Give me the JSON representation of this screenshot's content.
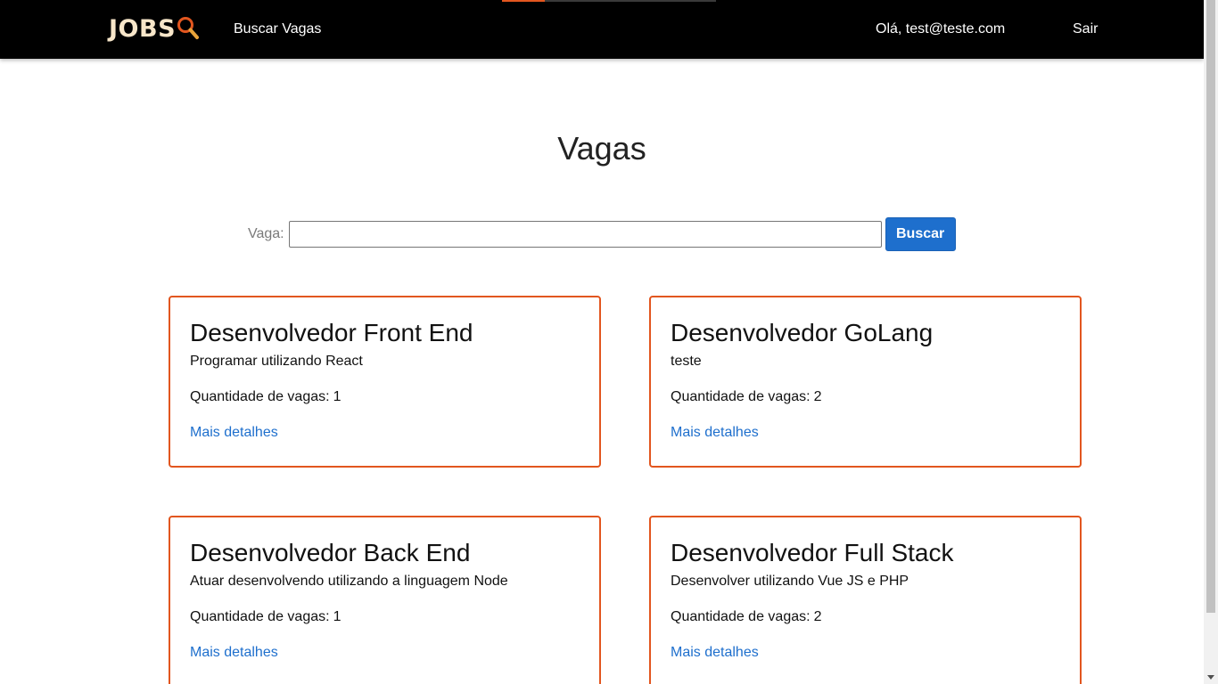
{
  "colors": {
    "navbar_bg": "#000000",
    "accent": "#e2561f",
    "primary": "#1e6fcd",
    "logo_text": "#f7e6c9"
  },
  "navbar": {
    "logo_text": "JOBS",
    "logo_icon": "magnifier-icon",
    "search_link": "Buscar Vagas",
    "greeting": "Olá, test@teste.com",
    "logout": "Sair"
  },
  "page": {
    "title": "Vagas"
  },
  "search": {
    "label": "Vaga:",
    "value": "",
    "button": "Buscar"
  },
  "jobs": [
    {
      "title": "Desenvolvedor Front End",
      "description": "Programar utilizando React",
      "quantity_label": "Quantidade de vagas:",
      "quantity": "1",
      "link": "Mais detalhes"
    },
    {
      "title": "Desenvolvedor GoLang",
      "description": "teste",
      "quantity_label": "Quantidade de vagas:",
      "quantity": "2",
      "link": "Mais detalhes"
    },
    {
      "title": "Desenvolvedor Back End",
      "description": "Atuar desenvolvendo utilizando a linguagem Node",
      "quantity_label": "Quantidade de vagas:",
      "quantity": "1",
      "link": "Mais detalhes"
    },
    {
      "title": "Desenvolvedor Full Stack",
      "description": "Desenvolver utilizando Vue JS e PHP",
      "quantity_label": "Quantidade de vagas:",
      "quantity": "2",
      "link": "Mais detalhes"
    }
  ]
}
